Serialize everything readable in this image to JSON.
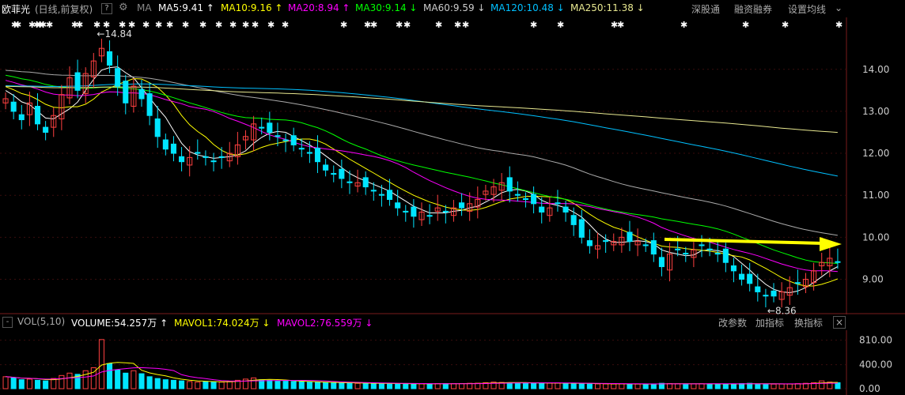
{
  "header": {
    "stock_name": "欧菲光",
    "mode": "(日线,前复权)",
    "help": "?",
    "ma_label": "MA",
    "ma5": "MA5:9.41 ↑",
    "ma10": "MA10:9.16 ↑",
    "ma20": "MA20:8.94 ↑",
    "ma30": "MA30:9.14 ↓",
    "ma60": "MA60:9.59 ↓",
    "ma120": "MA120:10.48 ↓",
    "ma250": "MA250:11.38 ↓",
    "btn_shenbo": "深股通",
    "btn_rongzi": "融资融券",
    "btn_settings": "设置均线"
  },
  "volume_header": {
    "toggle": "-",
    "title": "VOL(5,10)",
    "volume": "VOLUME:54.257万 ↑",
    "mavol1": "MAVOL1:74.024万 ↓",
    "mavol2": "MAVOL2:76.559万 ↓",
    "btn_param": "改参数",
    "btn_add": "加指标",
    "btn_switch": "换指标",
    "close": "×"
  },
  "colors": {
    "ma5": "#ffffff",
    "ma10": "#ffff00",
    "ma20": "#ff00ff",
    "ma30": "#00ff00",
    "ma60": "#aaaaaa",
    "ma120": "#00c0ff",
    "ma250": "#e8e890",
    "up": "#ff4040",
    "down": "#00e5ff",
    "arrow": "#ffff00"
  },
  "chart_data": {
    "type": "candlestick",
    "price_axis": {
      "ticks": [
        "14.00",
        "13.00",
        "12.00",
        "11.00",
        "10.00",
        "9.00"
      ],
      "ylim": [
        8.2,
        15.2
      ]
    },
    "volume_axis": {
      "ticks": [
        "810.00",
        "400.00",
        "0.00"
      ],
      "ylim": [
        0,
        950
      ]
    },
    "annotations": {
      "high": "←14.84",
      "low": "←8.36"
    },
    "markers": "✱",
    "closes": [
      13.3,
      13.0,
      12.8,
      13.2,
      12.7,
      12.5,
      12.9,
      13.4,
      13.8,
      13.5,
      13.9,
      14.2,
      14.5,
      14.1,
      13.6,
      13.2,
      13.6,
      13.3,
      12.9,
      12.4,
      12.1,
      12.0,
      11.8,
      11.9,
      12.0,
      11.9,
      11.8,
      11.9,
      12.0,
      12.2,
      12.4,
      12.7,
      12.6,
      12.5,
      12.4,
      12.3,
      12.2,
      12.1,
      12.0,
      11.8,
      11.6,
      11.5,
      11.4,
      11.3,
      11.3,
      11.2,
      11.1,
      11.0,
      10.9,
      10.7,
      10.6,
      10.5,
      10.6,
      10.5,
      10.7,
      10.6,
      10.7,
      10.7,
      10.8,
      10.9,
      11.1,
      11.2,
      11.3,
      11.1,
      11.0,
      10.9,
      10.8,
      10.6,
      10.7,
      10.8,
      10.6,
      10.3,
      10.0,
      9.8,
      9.8,
      9.9,
      9.9,
      10.0,
      9.9,
      9.9,
      9.8,
      9.6,
      9.3,
      9.6,
      9.7,
      9.6,
      9.7,
      9.8,
      9.7,
      9.6,
      9.4,
      9.2,
      9.0,
      8.9,
      8.7,
      8.6,
      8.6,
      8.7,
      8.8,
      8.9,
      9.0,
      9.2,
      9.4,
      9.5,
      9.4
    ],
    "volumes": [
      200,
      180,
      150,
      160,
      140,
      130,
      170,
      220,
      260,
      240,
      300,
      350,
      820,
      420,
      310,
      260,
      300,
      250,
      200,
      170,
      150,
      140,
      130,
      120,
      110,
      120,
      115,
      110,
      120,
      140,
      160,
      180,
      150,
      140,
      130,
      125,
      120,
      115,
      110,
      105,
      100,
      100,
      95,
      95,
      90,
      90,
      88,
      85,
      85,
      82,
      80,
      80,
      82,
      80,
      85,
      84,
      85,
      86,
      90,
      92,
      100,
      110,
      105,
      100,
      98,
      95,
      92,
      90,
      92,
      95,
      90,
      88,
      85,
      82,
      80,
      80,
      78,
      80,
      78,
      77,
      76,
      80,
      90,
      85,
      82,
      80,
      80,
      82,
      80,
      78,
      76,
      80,
      85,
      90,
      80,
      78,
      76,
      78,
      80,
      85,
      90,
      100,
      130,
      110,
      100
    ]
  }
}
